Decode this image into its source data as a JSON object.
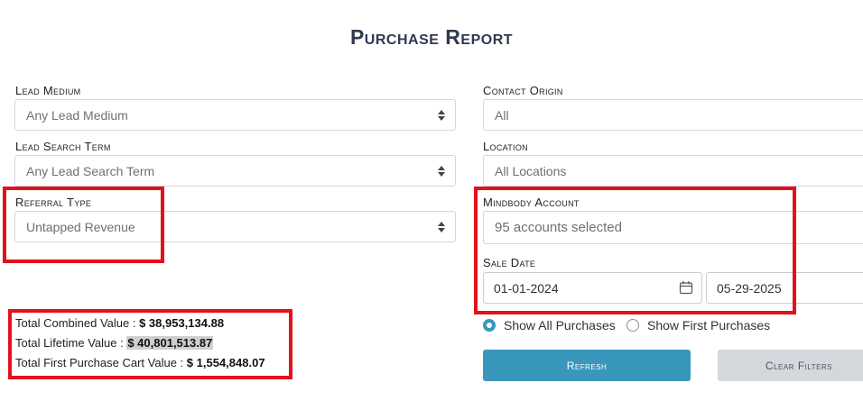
{
  "page": {
    "title": "Purchase Report"
  },
  "filters": {
    "lead_medium": {
      "label": "Lead Medium",
      "value": "Any Lead Medium"
    },
    "lead_search_term": {
      "label": "Lead Search Term",
      "value": "Any Lead Search Term"
    },
    "referral_type": {
      "label": "Referral Type",
      "value": "Untapped Revenue"
    },
    "contact_origin": {
      "label": "Contact Origin",
      "value": "All"
    },
    "location": {
      "label": "Location",
      "value": "All Locations"
    },
    "mindbody_account": {
      "label": "Mindbody Account",
      "value": "95 accounts selected"
    },
    "sale_date": {
      "label": "Sale Date",
      "start": "01-01-2024",
      "end": "05-29-2025"
    }
  },
  "totals": {
    "combined_label": "Total Combined Value :",
    "combined_value": "$ 38,953,134.88",
    "lifetime_label": "Total Lifetime Value :",
    "lifetime_value": "$ 40,801,513.87",
    "first_purchase_label": "Total First Purchase Cart Value :",
    "first_purchase_value": "$ 1,554,848.07"
  },
  "purchase_mode": {
    "options": [
      "Show All Purchases",
      "Show First Purchases"
    ],
    "selected": "Show All Purchases"
  },
  "actions": {
    "refresh_label": "Refresh",
    "clear_label": "Clear Filters"
  },
  "colors": {
    "accent": "#3a97bc",
    "highlight_border": "#e3111c",
    "title": "#2f3a4f"
  }
}
